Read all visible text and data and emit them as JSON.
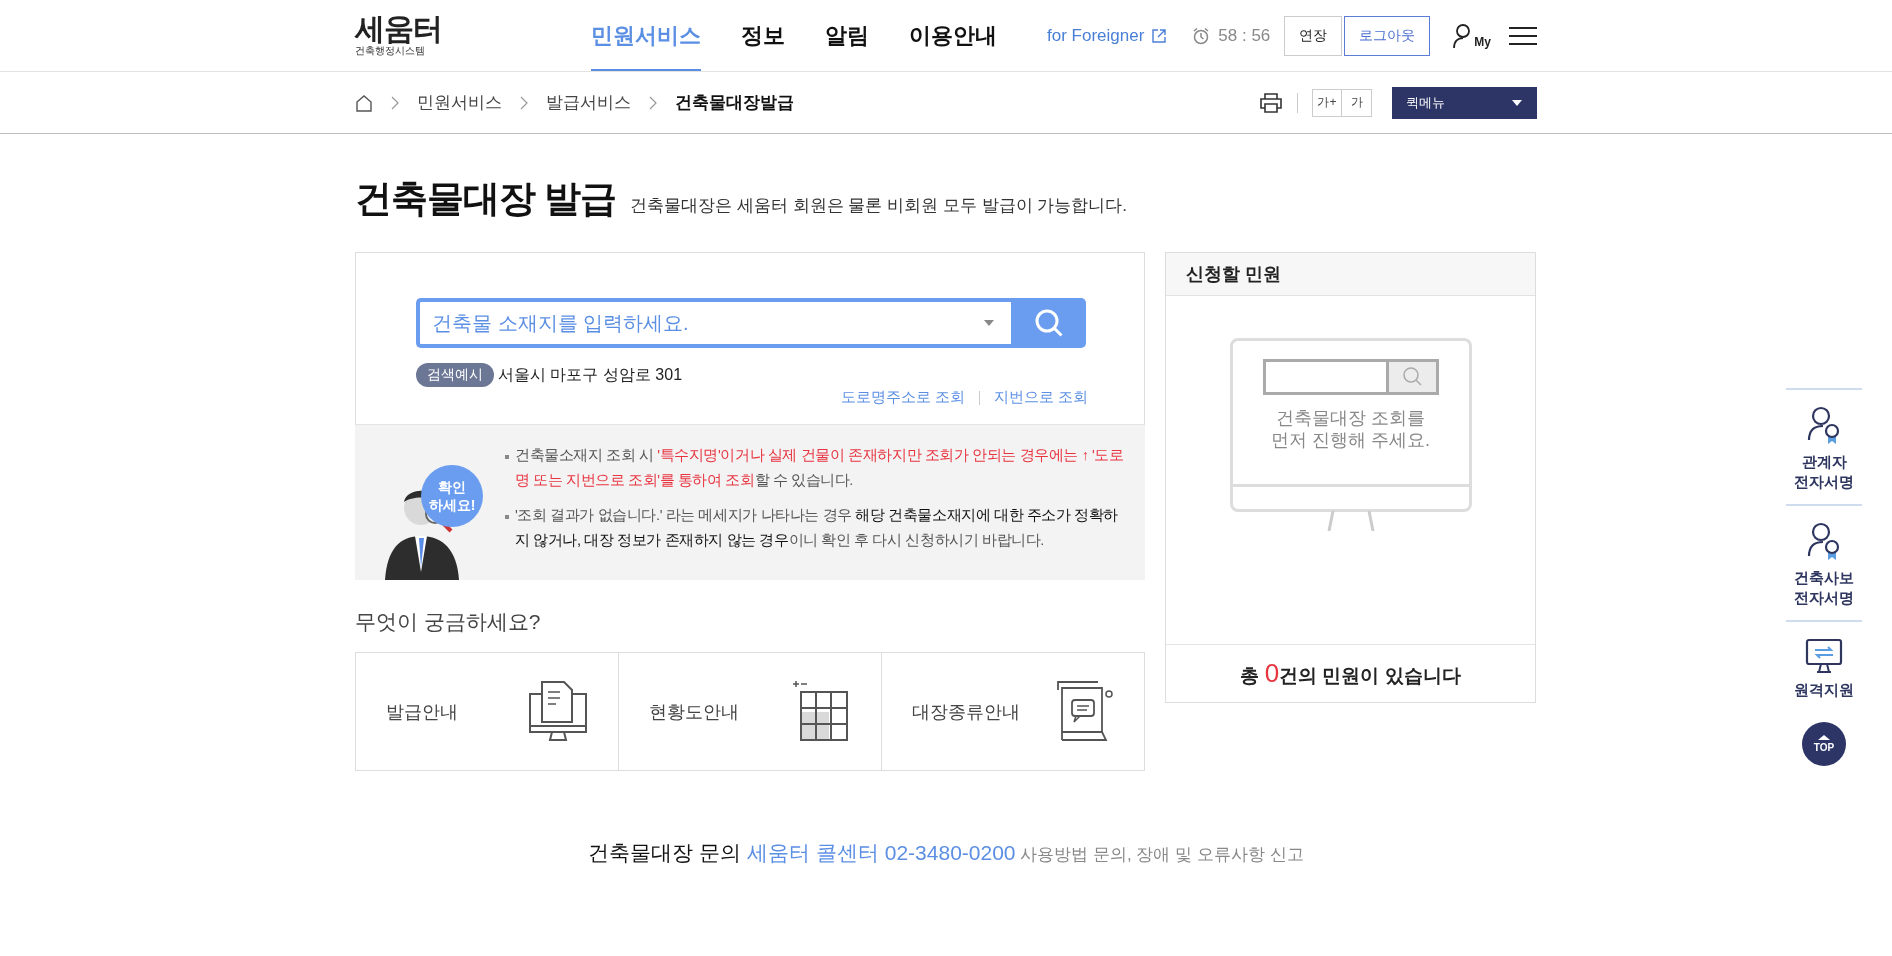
{
  "header": {
    "logo": {
      "title": "세움터",
      "subtitle": "건축행정시스템"
    },
    "nav": [
      {
        "label": "민원서비스",
        "selected": true
      },
      {
        "label": "정보",
        "selected": false
      },
      {
        "label": "알림",
        "selected": false
      },
      {
        "label": "이용안내",
        "selected": false
      }
    ],
    "foreigner_link": "for Foreigner",
    "timer": "58 : 56",
    "buttons": [
      {
        "label": "연장",
        "kind": "plain"
      },
      {
        "label": "로그아웃",
        "kind": "primary"
      }
    ],
    "my_label": "My"
  },
  "breadcrumb": [
    "민원서비스",
    "발급서비스",
    "건축물대장발급"
  ],
  "font_buttons": [
    "가+",
    "가"
  ],
  "quick_menu": "퀵메뉴",
  "page": {
    "title": "건축물대장 발급",
    "subtitle": "건축물대장은 세움터 회원은 물론 비회원 모두 발급이 가능합니다."
  },
  "search": {
    "placeholder": "건축물 소재지를 입력하세요.",
    "example_badge": "검색예시",
    "example": "서울시 마포구 성암로 301",
    "links": [
      "도로명주소로 조회",
      "지번으로 조회"
    ]
  },
  "notice": {
    "badge": [
      "확인",
      "하세요!"
    ],
    "items": [
      [
        {
          "kind": "text",
          "text": "건축물소재지 조회 시 "
        },
        {
          "kind": "red",
          "text": "'특수지명'이거나 실제 건물이 존재하지만 조회가 안되는 경우에는 ↑ '도로명 또는 지번으로 조회'를 통하여 조회"
        },
        {
          "kind": "text",
          "text": "할 수 있습니다."
        }
      ],
      [
        {
          "kind": "text",
          "text": "'조회 결과가 없습니다.' 라는 메세지가 나타나는 경우 "
        },
        {
          "kind": "strong",
          "text": "해당 건축물소재지에 대한 주소가 정확하지 않거나, 대장 정보가 존재하지 않는 경우"
        },
        {
          "kind": "text",
          "text": "이니 확인 후 다시 신청하시기 바랍니다."
        }
      ]
    ]
  },
  "faq": {
    "title": "무엇이 궁금하세요?",
    "cards": [
      {
        "label": "발급안내",
        "kind": "issue"
      },
      {
        "label": "현황도안내",
        "kind": "plan"
      },
      {
        "label": "대장종류안내",
        "kind": "types"
      }
    ]
  },
  "request_panel": {
    "title": "신청할 민원",
    "empty_message": [
      "건축물대장 조회를",
      "먼저 진행해 주세요."
    ],
    "total": [
      {
        "kind": "text",
        "text": "총 "
      },
      {
        "kind": "count",
        "text": "0"
      },
      {
        "kind": "text",
        "text": "건의 민원이 있습니다"
      }
    ]
  },
  "side_menu": [
    {
      "label": [
        "관계자",
        "전자서명"
      ],
      "kind": "signer"
    },
    {
      "label": [
        "건축사보",
        "전자서명"
      ],
      "kind": "signer"
    },
    {
      "label": [
        "원격지원"
      ],
      "kind": "remote"
    }
  ],
  "top_button": "TOP",
  "footer": [
    {
      "kind": "strong",
      "text": "건축물대장 문의 "
    },
    {
      "kind": "link",
      "text": "세움터 콜센터 02-3480-0200"
    },
    {
      "kind": "muted",
      "text": " 사용방법 문의, 장애 및 오류사항 신고"
    }
  ]
}
